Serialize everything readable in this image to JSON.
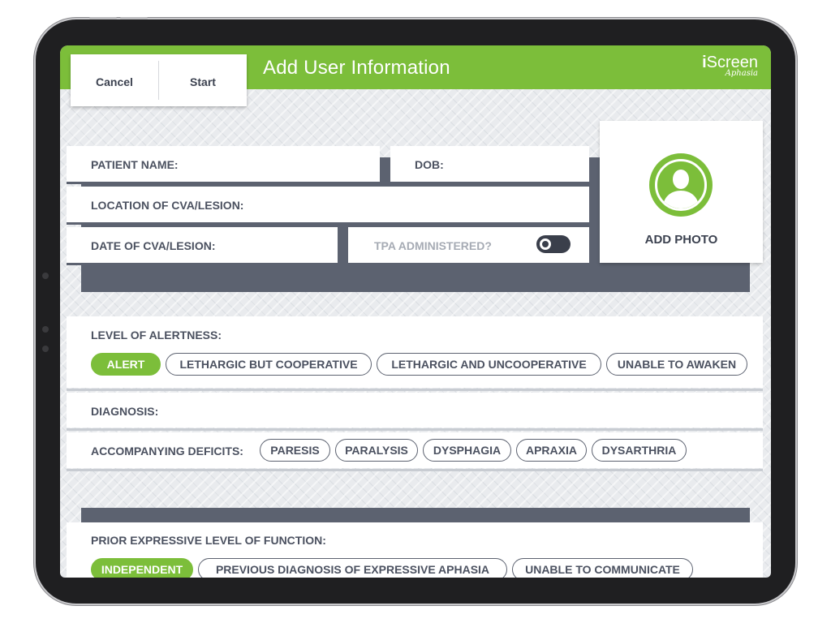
{
  "header": {
    "title": "Add User Information",
    "logo_main_bold": "i",
    "logo_main_rest": "Screen",
    "logo_sub": "Aphasia",
    "cancel_label": "Cancel",
    "start_label": "Start"
  },
  "patient": {
    "name_label": "PATIENT NAME:",
    "dob_label": "DOB:",
    "location_label": "LOCATION OF CVA/LESION:",
    "date_label": "DATE OF CVA/LESION:",
    "tpa_label": "TPA ADMINISTERED?",
    "tpa_on": false,
    "add_photo_label": "ADD PHOTO"
  },
  "alertness": {
    "label": "LEVEL OF ALERTNESS:",
    "options": [
      "ALERT",
      "LETHARGIC BUT COOPERATIVE",
      "LETHARGIC AND UNCOOPERATIVE",
      "UNABLE TO AWAKEN"
    ],
    "selected": "ALERT"
  },
  "diagnosis": {
    "label": "DIAGNOSIS:"
  },
  "deficits": {
    "label": "ACCOMPANYING DEFICITS:",
    "options": [
      "PARESIS",
      "PARALYSIS",
      "DYSPHAGIA",
      "APRAXIA",
      "DYSARTHRIA"
    ]
  },
  "expressive": {
    "label": "PRIOR EXPRESSIVE LEVEL OF FUNCTION:",
    "options": [
      "INDEPENDENT",
      "PREVIOUS DIAGNOSIS OF EXPRESSIVE APHASIA",
      "UNABLE TO COMMUNICATE"
    ],
    "selected": "INDEPENDENT"
  },
  "colors": {
    "accent_green": "#7cbe3a",
    "dark_slate": "#5c6270",
    "text": "#4b5160"
  }
}
